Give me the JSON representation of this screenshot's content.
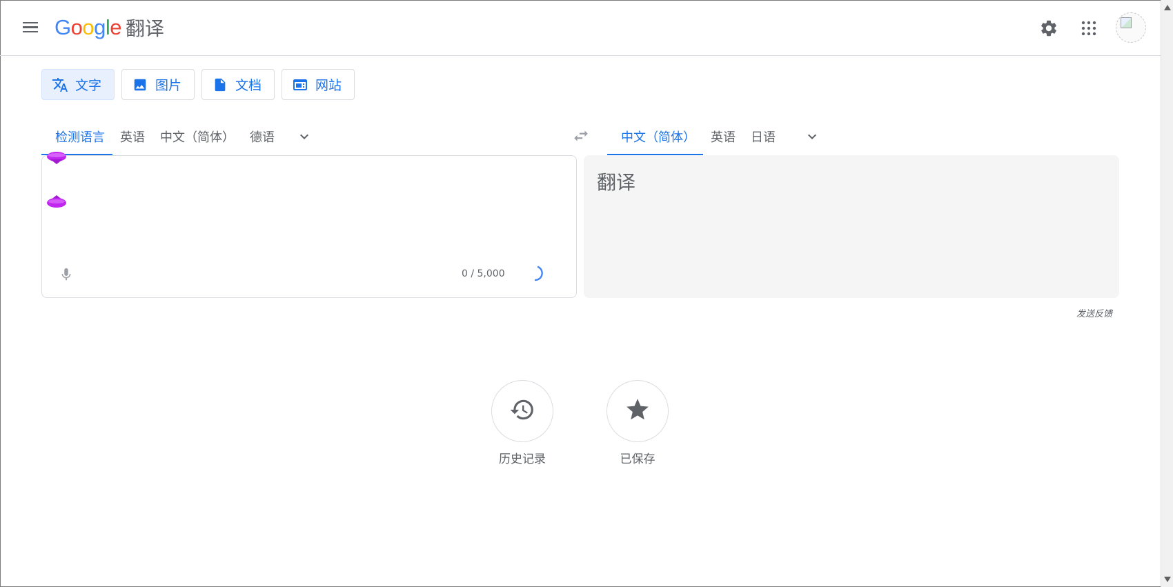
{
  "header": {
    "logo_google": [
      "G",
      "o",
      "o",
      "g",
      "l",
      "e"
    ],
    "product_name": "翻译",
    "settings_icon": "gear-icon",
    "apps_icon": "apps-grid-icon",
    "avatar_icon": "broken-image-avatar"
  },
  "modes": [
    {
      "label": "文字",
      "icon": "translate-icon",
      "active": true
    },
    {
      "label": "图片",
      "icon": "image-icon",
      "active": false
    },
    {
      "label": "文档",
      "icon": "document-icon",
      "active": false
    },
    {
      "label": "网站",
      "icon": "website-icon",
      "active": false
    }
  ],
  "source_languages": [
    "检测语言",
    "英语",
    "中文（简体）",
    "德语"
  ],
  "source_active_index": 0,
  "target_languages": [
    "中文（简体）",
    "英语",
    "日语"
  ],
  "target_active_index": 0,
  "source_panel": {
    "value": "",
    "char_count": "0 / 5,000"
  },
  "target_panel": {
    "placeholder": "翻译"
  },
  "feedback_label": "发送反馈",
  "actions": [
    {
      "label": "历史记录",
      "icon": "history-icon"
    },
    {
      "label": "已保存",
      "icon": "star-icon"
    }
  ],
  "colors": {
    "accent": "#1a73e8",
    "active_bg": "#e8f0fe",
    "output_bg": "#f5f5f5",
    "gem": "#c026f0"
  }
}
